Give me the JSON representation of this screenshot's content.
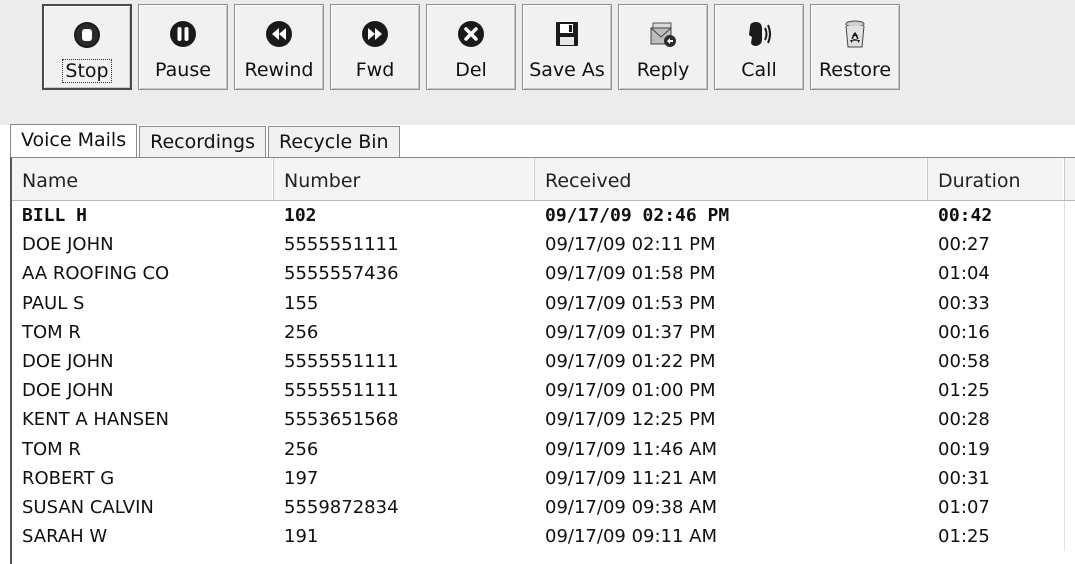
{
  "toolbar": {
    "buttons": [
      {
        "label": "Stop",
        "icon": "stop-icon"
      },
      {
        "label": "Pause",
        "icon": "pause-icon"
      },
      {
        "label": "Rewind",
        "icon": "rewind-icon"
      },
      {
        "label": "Fwd",
        "icon": "forward-icon"
      },
      {
        "label": "Del",
        "icon": "delete-icon"
      },
      {
        "label": "Save As",
        "icon": "floppy-disk-icon"
      },
      {
        "label": "Reply",
        "icon": "reply-envelope-icon"
      },
      {
        "label": "Call",
        "icon": "call-head-icon"
      },
      {
        "label": "Restore",
        "icon": "recycle-bin-icon"
      }
    ]
  },
  "tabs": [
    {
      "label": "Voice Mails",
      "active": true
    },
    {
      "label": "Recordings",
      "active": false
    },
    {
      "label": "Recycle Bin",
      "active": false
    }
  ],
  "table": {
    "columns": [
      "Name",
      "Number",
      "Received",
      "Duration"
    ],
    "rows": [
      {
        "name": "BILL H",
        "number": "102",
        "received": "09/17/09 02:46 PM",
        "duration": "00:42",
        "unread": true
      },
      {
        "name": "DOE JOHN",
        "number": "5555551111",
        "received": "09/17/09 02:11 PM",
        "duration": "00:27",
        "unread": false
      },
      {
        "name": "AA ROOFING CO",
        "number": "5555557436",
        "received": "09/17/09 01:58 PM",
        "duration": "01:04",
        "unread": false
      },
      {
        "name": "PAUL S",
        "number": "155",
        "received": "09/17/09 01:53 PM",
        "duration": "00:33",
        "unread": false
      },
      {
        "name": "TOM R",
        "number": "256",
        "received": "09/17/09 01:37 PM",
        "duration": "00:16",
        "unread": false
      },
      {
        "name": "DOE JOHN",
        "number": "5555551111",
        "received": "09/17/09 01:22 PM",
        "duration": "00:58",
        "unread": false
      },
      {
        "name": "DOE JOHN",
        "number": "5555551111",
        "received": "09/17/09 01:00 PM",
        "duration": "01:25",
        "unread": false
      },
      {
        "name": "KENT A HANSEN",
        "number": "5553651568",
        "received": "09/17/09 12:25 PM",
        "duration": "00:28",
        "unread": false
      },
      {
        "name": "TOM R",
        "number": "256",
        "received": "09/17/09 11:46 AM",
        "duration": "00:19",
        "unread": false
      },
      {
        "name": "ROBERT G",
        "number": "197",
        "received": "09/17/09 11:21 AM",
        "duration": "00:31",
        "unread": false
      },
      {
        "name": "SUSAN CALVIN",
        "number": "5559872834",
        "received": "09/17/09 09:38 AM",
        "duration": "01:07",
        "unread": false
      },
      {
        "name": "SARAH W",
        "number": "191",
        "received": "09/17/09 09:11 AM",
        "duration": "01:25",
        "unread": false
      }
    ]
  }
}
